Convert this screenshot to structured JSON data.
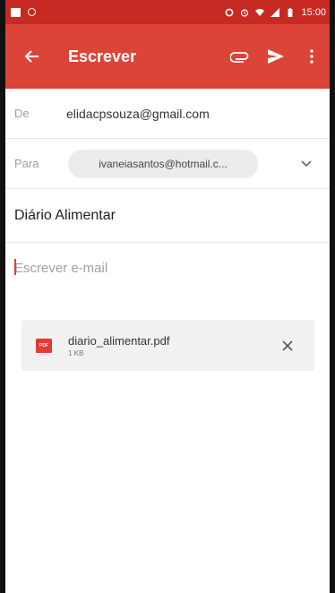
{
  "status_bar": {
    "time": "15:00",
    "icons": [
      "image-icon",
      "circle-icon",
      "data-saver-icon",
      "alarm-icon",
      "wifi-icon",
      "signal-icon",
      "battery-icon"
    ]
  },
  "app_bar": {
    "title": "Escrever",
    "back_icon": "arrow-back-icon",
    "attach_icon": "paperclip-icon",
    "send_icon": "send-icon",
    "more_icon": "more-vert-icon"
  },
  "compose": {
    "from_label": "De",
    "from_value": "elidacpsouza@gmail.com",
    "to_label": "Para",
    "to_chip": "ivaneiasantos@hotmail.c...",
    "subject": "Diário Alimentar",
    "body_placeholder": "Escrever e-mail"
  },
  "attachment": {
    "name": "diario_alimentar.pdf",
    "size": "1 KB",
    "badge": "PDF"
  },
  "colors": {
    "status_bar": "#c62a22",
    "app_bar": "#db4437",
    "chip": "#ececec",
    "attachment_bg": "#f1f1f1",
    "pdf_red": "#e53935"
  }
}
